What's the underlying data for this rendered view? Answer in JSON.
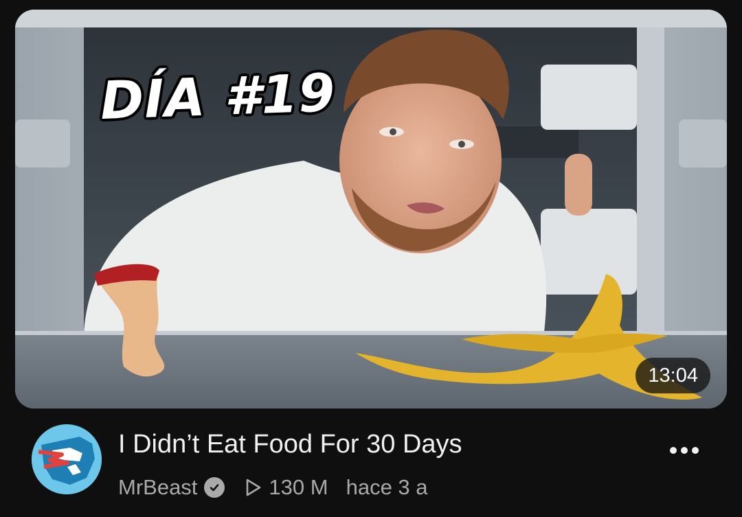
{
  "video": {
    "thumbnail_overlay_text": "DÍA #19",
    "duration": "13:04",
    "title": "I Didn’t Eat Food For 30 Days",
    "channel": "MrBeast",
    "views": "130 M",
    "age": "hace 3 a"
  },
  "icons": {
    "verified": "verified-check-icon",
    "views": "play-outline-icon",
    "menu": "more-horizontal-icon",
    "avatar": "channel-avatar"
  },
  "colors": {
    "background": "#0f0f0f",
    "title_text": "#f1f1f1",
    "secondary_text": "#aaaaaa",
    "avatar_bg": "#6dc7ea"
  }
}
